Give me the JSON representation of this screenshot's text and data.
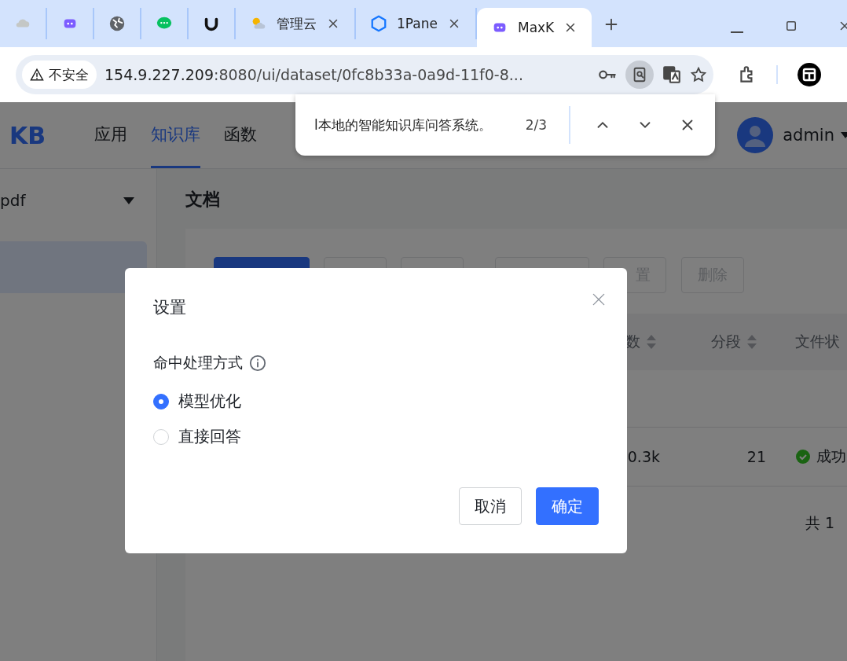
{
  "browser": {
    "tabs": [
      {
        "selected": false
      },
      {
        "selected": false
      },
      {
        "selected": false
      },
      {
        "selected": false
      },
      {
        "selected": false
      },
      {
        "label": "管理云",
        "selected": false,
        "closable": true
      },
      {
        "label": "1Pane",
        "selected": false,
        "closable": true
      },
      {
        "label": "MaxK",
        "selected": true,
        "closable": true
      }
    ],
    "security": "不安全",
    "url_host": "154.9.227.209",
    "url_rest": ":8080/ui/dataset/0fc8b33a-0a9d-11f0-8..."
  },
  "find_bar": {
    "query": "l本地的智能知识库问答系统。",
    "count": "2/3"
  },
  "app": {
    "logo": "KB",
    "nav": [
      {
        "label": "应用",
        "selected": false
      },
      {
        "label": "知识库",
        "selected": true
      },
      {
        "label": "函数",
        "selected": false
      }
    ],
    "user": "admin"
  },
  "sidebar": {
    "dataset": "pdf"
  },
  "main": {
    "title": "文档",
    "buttons": [
      {
        "primary": true
      },
      {
        "primary": false
      },
      {
        "primary": false
      },
      {
        "primary": false
      },
      {
        "label": "置",
        "primary": false
      },
      {
        "label": "删除",
        "primary": false
      }
    ],
    "columns": [
      "数",
      "分段",
      "文件状"
    ],
    "row": [
      "0.3k",
      "21",
      "成功"
    ],
    "total": "共 1"
  },
  "dialog": {
    "title": "设置",
    "field_label": "命中处理方式",
    "options": [
      {
        "label": "模型优化",
        "selected": true
      },
      {
        "label": "直接回答",
        "selected": false
      }
    ],
    "cancel": "取消",
    "confirm": "确定"
  }
}
